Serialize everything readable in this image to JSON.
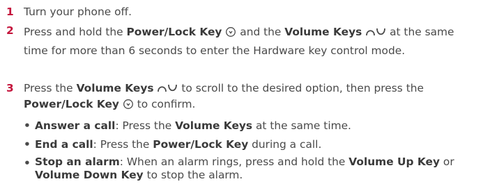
{
  "steps": [
    {
      "number": "1",
      "text": "Turn your phone off."
    },
    {
      "number": "2",
      "t1": "Press and hold the ",
      "b1": "Power/Lock Key",
      "t2": " and the ",
      "b2": "Volume Keys",
      "t3": " at the same time for more than 6 seconds to enter the Hardware key control mode."
    },
    {
      "number": "3",
      "t1": "Press the ",
      "b1": "Volume Keys",
      "t2": " to scroll to the desired option, then press the ",
      "b2": "Power/Lock Key",
      "t3": " to confirm."
    }
  ],
  "bullets": [
    {
      "marker": "•",
      "label": "Answer a call",
      "t1": ": Press the ",
      "b1": "Volume Keys",
      "t2": " at the same time."
    },
    {
      "marker": "•",
      "label": "End a call",
      "t1": ": Press the ",
      "b1": "Power/Lock Key",
      "t2": " during a call."
    },
    {
      "marker": "•",
      "label": "Stop an alarm",
      "t1": ": When an alarm rings, press and hold the ",
      "b1": "Volume Up Key",
      "t2": " or ",
      "b2": "Volume Down Key",
      "t3": " to stop the alarm."
    }
  ],
  "colors": {
    "step_number": "#c4143c",
    "body_text": "#4a4a4a"
  },
  "icons": {
    "power": "power-lock-key-icon",
    "volume": "volume-keys-icon"
  }
}
